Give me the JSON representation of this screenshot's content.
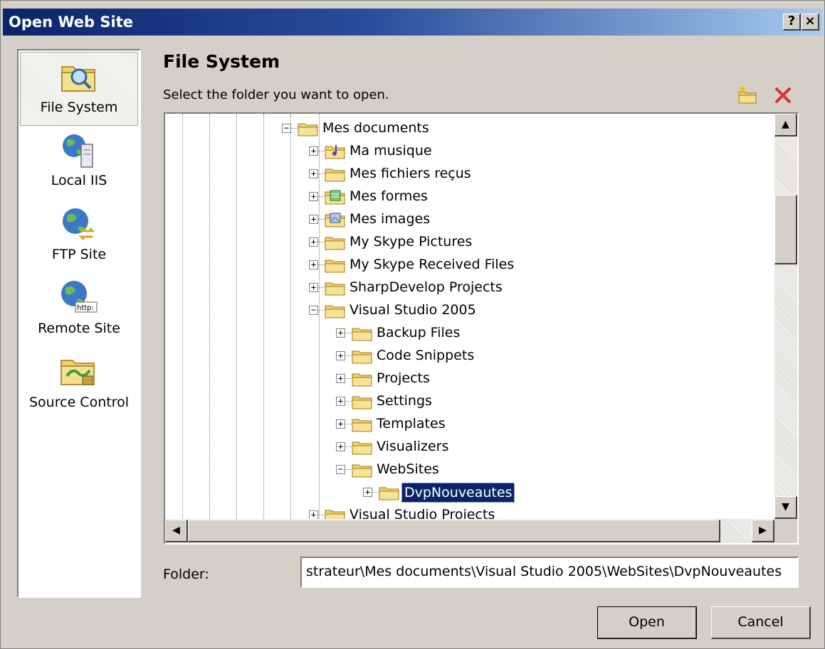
{
  "window": {
    "title": "Open Web Site",
    "help_glyph": "?",
    "close_glyph": "×"
  },
  "nav": {
    "items": [
      {
        "label": "File System",
        "icon": "folder-search-icon",
        "selected": true
      },
      {
        "label": "Local IIS",
        "icon": "local-iis-server-icon"
      },
      {
        "label": "FTP Site",
        "icon": "ftp-globe-icon"
      },
      {
        "label": "Remote Site",
        "icon": "remote-site-http-icon"
      },
      {
        "label": "Source Control",
        "icon": "source-control-icon"
      }
    ]
  },
  "main": {
    "heading": "File System",
    "instruction": "Select the folder you want to open.",
    "toolbar": {
      "new_folder_icon": "new-folder-icon",
      "delete_icon": "delete-icon"
    }
  },
  "tree": {
    "nodes": [
      {
        "label": "Mes documents",
        "expander": "minus"
      },
      {
        "label": "Ma musique",
        "expander": "plus"
      },
      {
        "label": "Mes fichiers reçus",
        "expander": "plus"
      },
      {
        "label": "Mes formes",
        "expander": "plus"
      },
      {
        "label": "Mes images",
        "expander": "plus"
      },
      {
        "label": "My Skype Pictures",
        "expander": "plus"
      },
      {
        "label": "My Skype Received Files",
        "expander": "plus"
      },
      {
        "label": "SharpDevelop Projects",
        "expander": "plus"
      },
      {
        "label": "Visual Studio 2005",
        "expander": "minus"
      },
      {
        "label": "Backup Files",
        "expander": "plus"
      },
      {
        "label": "Code Snippets",
        "expander": "plus"
      },
      {
        "label": "Projects",
        "expander": "plus"
      },
      {
        "label": "Settings",
        "expander": "plus"
      },
      {
        "label": "Templates",
        "expander": "plus"
      },
      {
        "label": "Visualizers",
        "expander": "plus"
      },
      {
        "label": "WebSites",
        "expander": "minus"
      },
      {
        "label": "DvpNouveautes",
        "expander": "plus",
        "selected": true
      },
      {
        "label": "Visual Studio Projects",
        "expander": "plus"
      }
    ]
  },
  "folder_field": {
    "label": "Folder:",
    "value": "strateur\\Mes documents\\Visual Studio 2005\\WebSites\\DvpNouveautes"
  },
  "buttons": {
    "open": "Open",
    "cancel": "Cancel"
  },
  "colors": {
    "titlebar_start": "#0a246a",
    "titlebar_end": "#a6caf0",
    "selection": "#0a246a",
    "dialog_face": "#d4d0c8"
  }
}
